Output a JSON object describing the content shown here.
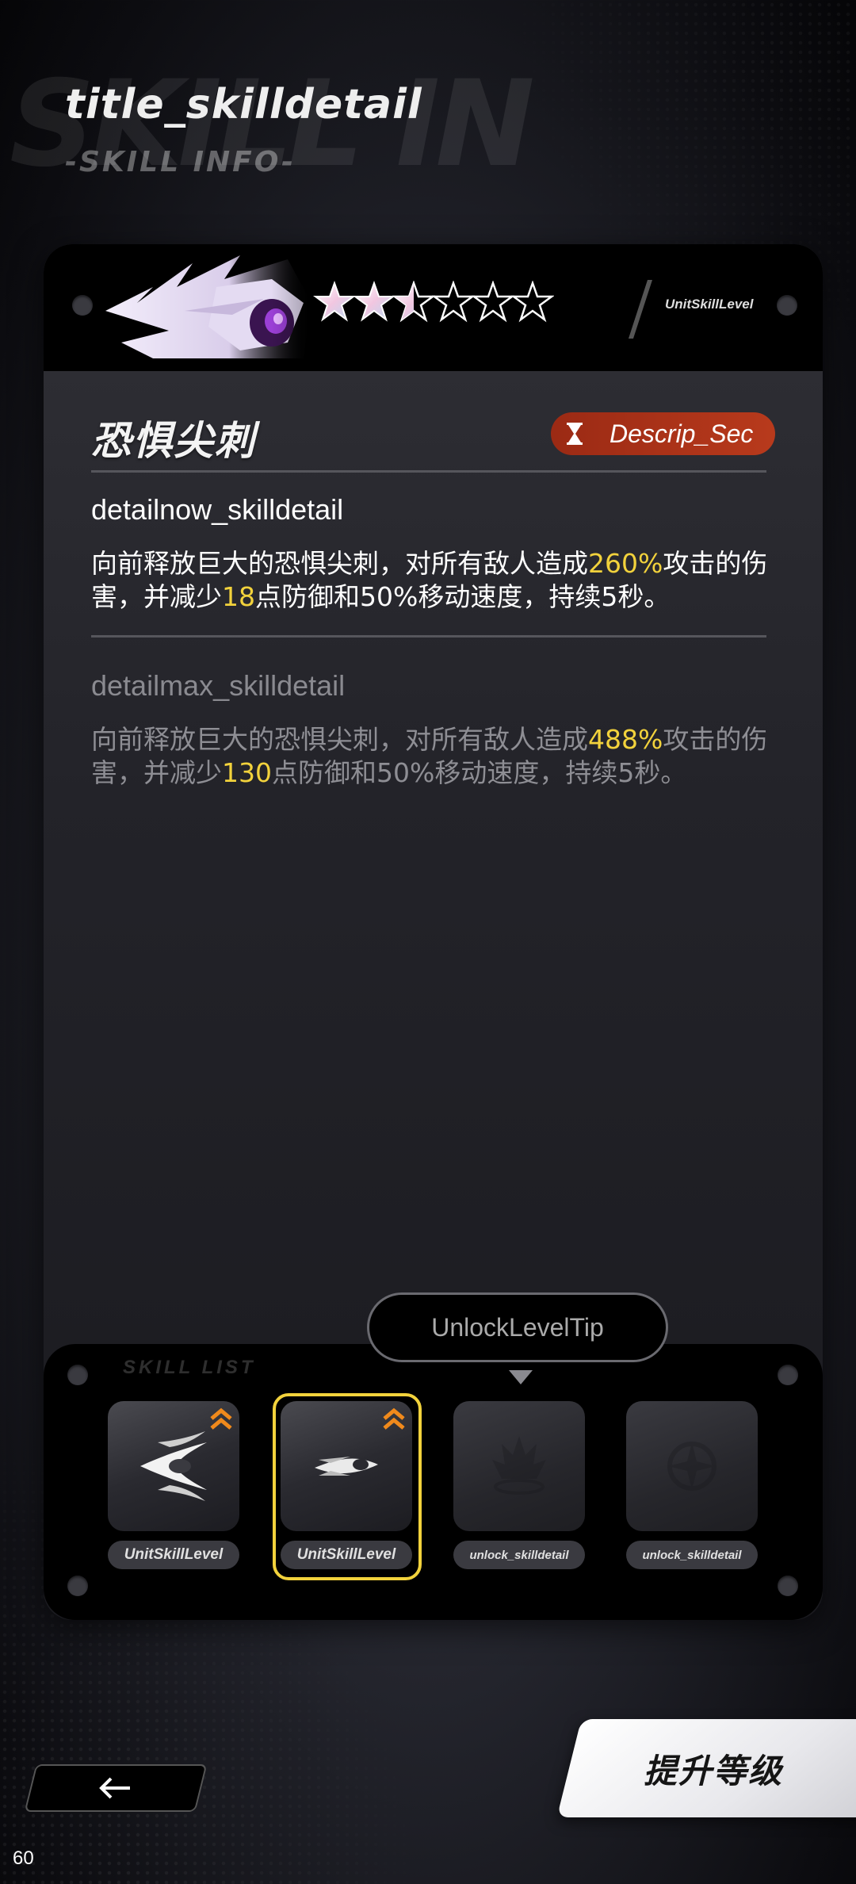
{
  "header": {
    "title": "title_skilldetail",
    "subtitle": "-SKILL INFO-",
    "bg_text": "SKILL IN"
  },
  "skill_card": {
    "unit_level_label": "UnitSkillLevel",
    "stars_total": 6,
    "stars_filled": 2.5,
    "skill_name": "恐惧尖刺",
    "cooldown_label": "Descrip_Sec",
    "current": {
      "title": "detailnow_skilldetail",
      "desc_pre": "向前释放巨大的恐惧尖刺，对所有敌人造成",
      "desc_val1": "260%",
      "desc_mid": "攻击的伤害，并减少",
      "desc_val2": "18",
      "desc_post": "点防御和50%移动速度，持续5秒。"
    },
    "max": {
      "title": "detailmax_skilldetail",
      "desc_pre": "向前释放巨大的恐惧尖刺，对所有敌人造成",
      "desc_val1": "488%",
      "desc_mid": "攻击的伤害，并减少",
      "desc_val2": "130",
      "desc_post": "点防御和50%移动速度，持续5秒。"
    }
  },
  "unlock_tip": "UnlockLevelTip",
  "skill_list": {
    "label": "SKILL LIST",
    "slots": [
      {
        "label": "UnitSkillLevel",
        "state": "unlocked",
        "upgradable": true,
        "selected": false,
        "icon": "triple-blade-icon"
      },
      {
        "label": "UnitSkillLevel",
        "state": "unlocked",
        "upgradable": true,
        "selected": true,
        "icon": "spike-burst-icon"
      },
      {
        "label": "unlock_skilldetail",
        "state": "locked",
        "upgradable": false,
        "selected": false,
        "icon": "flame-crown-icon"
      },
      {
        "label": "unlock_skilldetail",
        "state": "locked",
        "upgradable": false,
        "selected": false,
        "icon": "compass-star-icon"
      }
    ]
  },
  "buttons": {
    "upgrade": "提升等级"
  },
  "fps": "60",
  "colors": {
    "highlight": "#f2d23c",
    "cooldown_badge": "#b83a1c",
    "selected_border": "#f2d23c",
    "upgrade_arrow": "#f08a1c"
  }
}
